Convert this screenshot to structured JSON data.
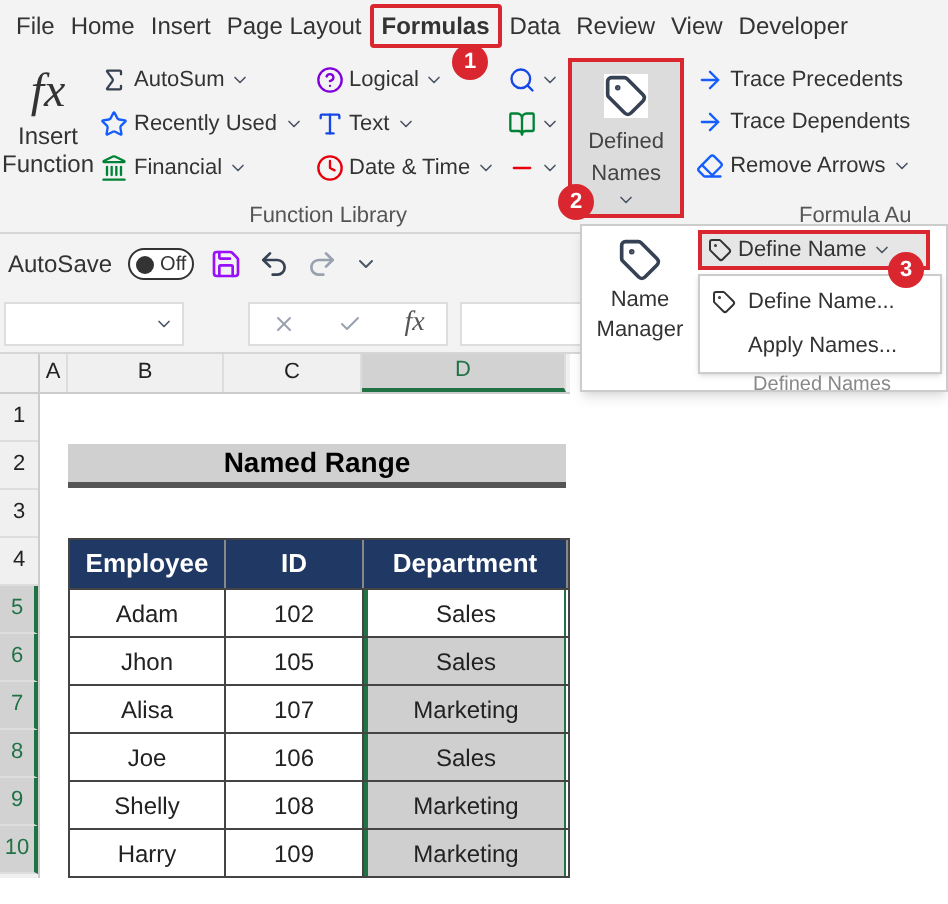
{
  "menu_tabs": [
    {
      "label": "File",
      "selected": false,
      "highlighted": false
    },
    {
      "label": "Home",
      "selected": false,
      "highlighted": false
    },
    {
      "label": "Insert",
      "selected": false,
      "highlighted": false
    },
    {
      "label": "Page Layout",
      "selected": false,
      "highlighted": false
    },
    {
      "label": "Formulas",
      "selected": true,
      "highlighted": true
    },
    {
      "label": "Data",
      "selected": false,
      "highlighted": false
    },
    {
      "label": "Review",
      "selected": false,
      "highlighted": false
    },
    {
      "label": "View",
      "selected": false,
      "highlighted": false
    },
    {
      "label": "Developer",
      "selected": false,
      "highlighted": false
    }
  ],
  "ribbon": {
    "insert_function": {
      "icon": "fx",
      "label": "Insert Function"
    },
    "function_library": {
      "label": "Function Library",
      "column_1": [
        {
          "label": "AutoSum",
          "kind": "sum"
        },
        {
          "label": "Recently Used",
          "kind": "star"
        },
        {
          "label": "Financial",
          "kind": "money"
        }
      ],
      "column_2": [
        {
          "label": "Logical",
          "kind": "question"
        },
        {
          "label": "Text",
          "kind": "letter"
        },
        {
          "label": "Date & Time",
          "kind": "clock"
        }
      ]
    },
    "defined_names": {
      "label": "Defined Names",
      "highlighted": true
    },
    "formula_auditing": {
      "label": "Formula Au",
      "items": [
        {
          "label": "Trace Precedents"
        },
        {
          "label": "Trace Dependents"
        },
        {
          "label": "Remove Arrows"
        }
      ]
    }
  },
  "quick_access": {
    "autosave_label": "AutoSave",
    "toggle": {
      "on": false,
      "label": "Off"
    }
  },
  "formula_bar": {
    "fx": "fx"
  },
  "dropdown": {
    "name_manager": "Name Manager",
    "define_name": {
      "label": "Define Name",
      "highlighted": true
    },
    "menu": [
      {
        "label": "Define Name..."
      },
      {
        "label": "Apply Names..."
      }
    ],
    "group_label": "Defined Names"
  },
  "badges": [
    "1",
    "2",
    "3"
  ],
  "sheet": {
    "columns": [
      {
        "label": "A",
        "selected": false
      },
      {
        "label": "B",
        "selected": false
      },
      {
        "label": "C",
        "selected": false
      },
      {
        "label": "D",
        "selected": true
      }
    ],
    "rows": [
      {
        "label": "1",
        "selected": false
      },
      {
        "label": "2",
        "selected": false
      },
      {
        "label": "3",
        "selected": false
      },
      {
        "label": "4",
        "selected": false
      },
      {
        "label": "5",
        "selected": true
      },
      {
        "label": "6",
        "selected": true
      },
      {
        "label": "7",
        "selected": true
      },
      {
        "label": "8",
        "selected": true
      },
      {
        "label": "9",
        "selected": true
      },
      {
        "label": "10",
        "selected": true
      }
    ],
    "title": "Named Range",
    "table": {
      "columns": [
        "Employee",
        "ID",
        "Department"
      ],
      "rows": [
        {
          "cells": [
            "Adam",
            "102",
            "Sales"
          ],
          "selected": true,
          "active": true
        },
        {
          "cells": [
            "Jhon",
            "105",
            "Sales"
          ],
          "selected": true,
          "active": false
        },
        {
          "cells": [
            "Alisa",
            "107",
            "Marketing"
          ],
          "selected": true,
          "active": false
        },
        {
          "cells": [
            "Joe",
            "106",
            "Sales"
          ],
          "selected": true,
          "active": false
        },
        {
          "cells": [
            "Shelly",
            "108",
            "Marketing"
          ],
          "selected": true,
          "active": false
        },
        {
          "cells": [
            "Harry",
            "109",
            "Marketing"
          ],
          "selected": true,
          "active": false
        }
      ]
    }
  }
}
